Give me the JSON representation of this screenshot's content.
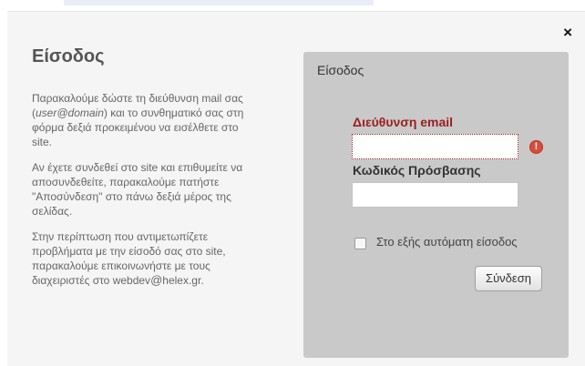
{
  "window": {
    "close_label": "×"
  },
  "left": {
    "title": "Είσοδος",
    "p1_a": "Παρακαλούμε δώστε τη διεύθυνση mail σας",
    "p1_b_em": "user@domain",
    "p1_b_rest": ") και το συνθηματικό σας στη",
    "p1_c": "φόρμα δεξιά προκειμένου να εισέλθετε στο",
    "p1_d": "site.",
    "p2_a": "Αν έχετε συνδεθεί στο site και επιθυμείτε να",
    "p2_b": "αποσυνδεθείτε, παρακαλούμε πατήστε",
    "p2_c": "\"Αποσύνδεση\" στο πάνω δεξιά μέρος της",
    "p2_d": "σελίδας.",
    "p3_a": "Στην περίπτωση που αντιμετωπίζετε",
    "p3_b": "προβλήματα με την είσοδό σας στο site,",
    "p3_c": "παρακαλούμε επικοινωνήστε με τους",
    "p3_d_pre": "διαχειριστές στο webdev",
    "p3_d_at": "@",
    "p3_d_post": "helex.gr."
  },
  "form": {
    "title": "Είσοδος",
    "email_label": "Διεύθυνση email",
    "email_value": "",
    "error_icon": "!",
    "password_label": "Κωδικός Πρόσβασης",
    "password_value": "",
    "remember_label": "Στο εξής αυτόματη είσοδος",
    "submit_label": "Σύνδεση"
  }
}
